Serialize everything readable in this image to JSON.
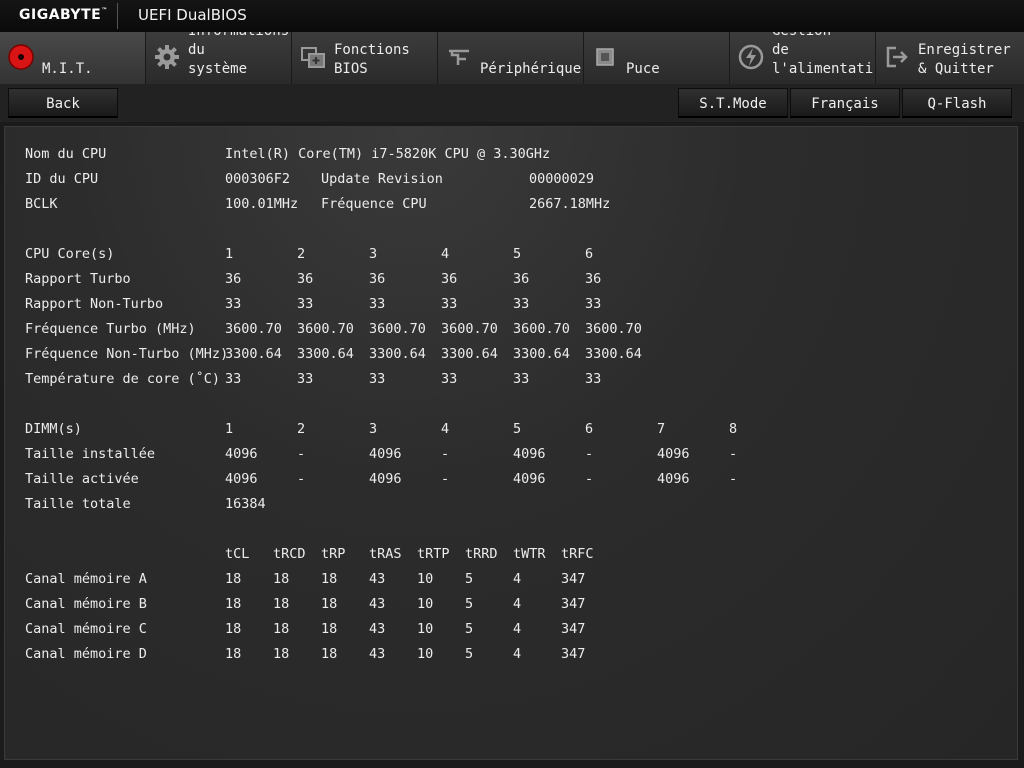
{
  "header": {
    "brand": "GIGABYTE",
    "brand_tm": "™",
    "product": "UEFI DualBIOS"
  },
  "tabs": [
    {
      "label": "M.I.T.",
      "icon": "red-circle-icon",
      "active": true
    },
    {
      "label": "Informations\ndu\nsystème",
      "icon": "gear-icon"
    },
    {
      "label": "Fonctions\nBIOS",
      "icon": "bios-features-icon"
    },
    {
      "label": "Périphériques",
      "icon": "peripherals-icon"
    },
    {
      "label": "Puce",
      "icon": "chipset-icon"
    },
    {
      "label": "Gestion\nde\nl'alimentatio",
      "icon": "power-icon"
    },
    {
      "label": "Enregistrer\n& Quitter",
      "icon": "exit-icon"
    }
  ],
  "buttons": {
    "back": "Back",
    "st_mode": "S.T.Mode",
    "language": "Français",
    "qflash": "Q-Flash"
  },
  "cpu": {
    "name_label": "Nom du CPU",
    "name_value": "Intel(R) Core(TM) i7-5820K CPU @ 3.30GHz",
    "id_label": "ID du CPU",
    "id_value": "000306F2",
    "update_label": "Update Revision",
    "update_value": "00000029",
    "bclk_label": "BCLK",
    "bclk_value": "100.01MHz",
    "freq_label": "Fréquence CPU",
    "freq_value": "2667.18MHz"
  },
  "cores": {
    "header_label": "CPU Core(s)",
    "columns": [
      "1",
      "2",
      "3",
      "4",
      "5",
      "6"
    ],
    "rows": [
      {
        "label": "Rapport Turbo",
        "values": [
          "36",
          "36",
          "36",
          "36",
          "36",
          "36"
        ]
      },
      {
        "label": "Rapport Non-Turbo",
        "values": [
          "33",
          "33",
          "33",
          "33",
          "33",
          "33"
        ]
      },
      {
        "label": "Fréquence Turbo (MHz)",
        "values": [
          "3600.70",
          "3600.70",
          "3600.70",
          "3600.70",
          "3600.70",
          "3600.70"
        ]
      },
      {
        "label": "Fréquence Non-Turbo (MHz)",
        "values": [
          "3300.64",
          "3300.64",
          "3300.64",
          "3300.64",
          "3300.64",
          "3300.64"
        ]
      },
      {
        "label": "Température de core (˚C)",
        "values": [
          "33",
          "33",
          "33",
          "33",
          "33",
          "33"
        ]
      }
    ]
  },
  "dimms": {
    "header_label": "DIMM(s)",
    "columns": [
      "1",
      "2",
      "3",
      "4",
      "5",
      "6",
      "7",
      "8"
    ],
    "rows": [
      {
        "label": "Taille installée",
        "values": [
          "4096",
          "-",
          "4096",
          "-",
          "4096",
          "-",
          "4096",
          "-"
        ]
      },
      {
        "label": "Taille activée",
        "values": [
          "4096",
          "-",
          "4096",
          "-",
          "4096",
          "-",
          "4096",
          "-"
        ]
      }
    ],
    "total_label": "Taille totale",
    "total_value": "16384"
  },
  "timings": {
    "columns": [
      "tCL",
      "tRCD",
      "tRP",
      "tRAS",
      "tRTP",
      "tRRD",
      "tWTR",
      "tRFC"
    ],
    "rows": [
      {
        "label": "Canal mémoire A",
        "values": [
          "18",
          "18",
          "18",
          "43",
          "10",
          "5",
          "4",
          "347"
        ]
      },
      {
        "label": "Canal mémoire B",
        "values": [
          "18",
          "18",
          "18",
          "43",
          "10",
          "5",
          "4",
          "347"
        ]
      },
      {
        "label": "Canal mémoire C",
        "values": [
          "18",
          "18",
          "18",
          "43",
          "10",
          "5",
          "4",
          "347"
        ]
      },
      {
        "label": "Canal mémoire D",
        "values": [
          "18",
          "18",
          "18",
          "43",
          "10",
          "5",
          "4",
          "347"
        ]
      }
    ]
  }
}
